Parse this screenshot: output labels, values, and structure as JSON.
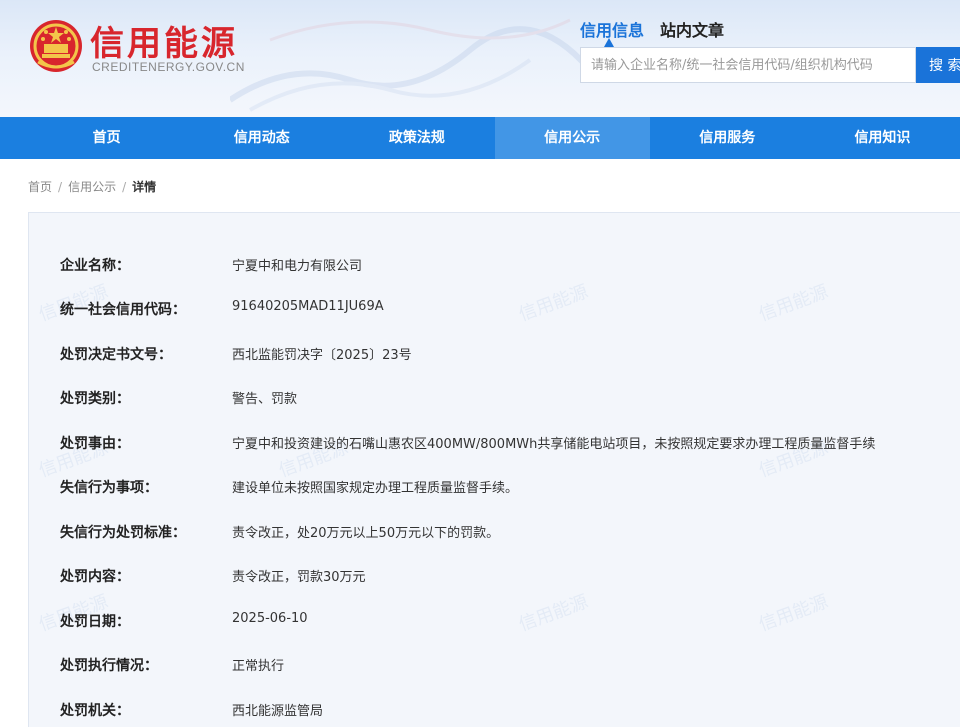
{
  "header": {
    "brand_title": "信用能源",
    "brand_domain": "CREDITENERGY.GOV.CN",
    "search_tabs": [
      "信用信息",
      "站内文章"
    ],
    "search_placeholder": "请输入企业名称/统一社会信用代码/组织机构代码",
    "search_button": "搜 索"
  },
  "nav": {
    "items": [
      "首页",
      "信用动态",
      "政策法规",
      "信用公示",
      "信用服务",
      "信用知识"
    ],
    "active_index": 3
  },
  "breadcrumb": {
    "items": [
      "首页",
      "信用公示",
      "详情"
    ],
    "separator": "/"
  },
  "watermark_text": "信用能源",
  "detail": {
    "rows": [
      {
        "label": "企业名称：",
        "value": "宁夏中和电力有限公司"
      },
      {
        "label": "统一社会信用代码：",
        "value": "91640205MAD11JU69A"
      },
      {
        "label": "处罚决定书文号：",
        "value": "西北监能罚决字〔2025〕23号"
      },
      {
        "label": "处罚类别：",
        "value": "警告、罚款"
      },
      {
        "label": "处罚事由：",
        "value": "宁夏中和投资建设的石嘴山惠农区400MW/800MWh共享储能电站项目，未按照规定要求办理工程质量监督手续"
      },
      {
        "label": "失信行为事项：",
        "value": "建设单位未按照国家规定办理工程质量监督手续。"
      },
      {
        "label": "失信行为处罚标准：",
        "value": "责令改正，处20万元以上50万元以下的罚款。"
      },
      {
        "label": "处罚内容：",
        "value": "责令改正，罚款30万元"
      },
      {
        "label": "处罚日期：",
        "value": "2025-06-10"
      },
      {
        "label": "处罚执行情况：",
        "value": "正常执行"
      },
      {
        "label": "处罚机关：",
        "value": "西北能源监管局"
      }
    ]
  },
  "colors": {
    "brand_red": "#d8262d",
    "nav_blue": "#1b7fe0",
    "nav_active": "#4296e6",
    "accent_blue": "#1a73d9",
    "panel_bg": "#f3f6fb"
  }
}
